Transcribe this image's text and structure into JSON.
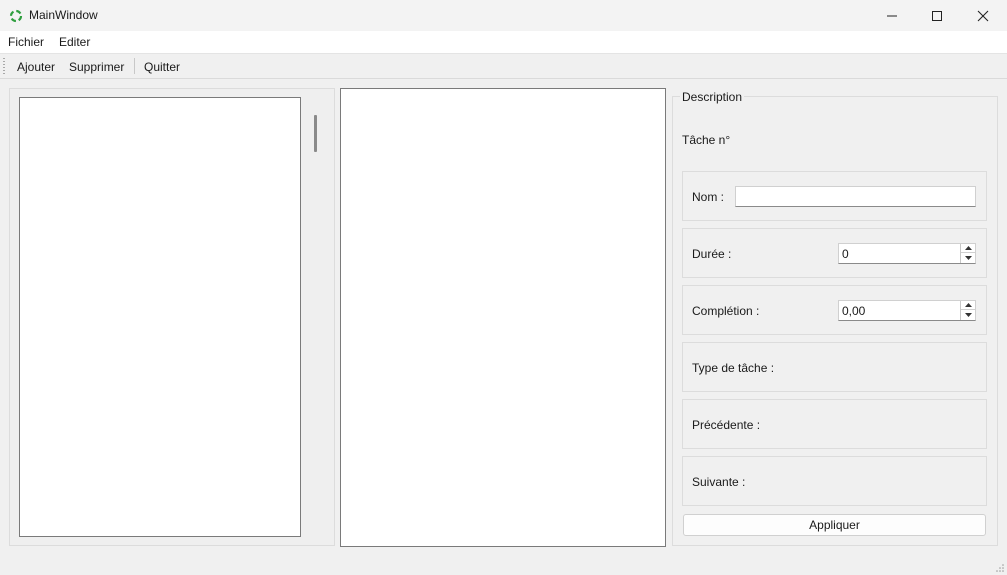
{
  "window": {
    "title": "MainWindow"
  },
  "menu": {
    "items": [
      "Fichier",
      "Editer"
    ]
  },
  "toolbar": {
    "add": "Ajouter",
    "delete": "Supprimer",
    "quit": "Quitter"
  },
  "description": {
    "title": "Description",
    "task_label": "Tâche n°",
    "name_label": "Nom :",
    "name_value": "",
    "duration_label": "Durée :",
    "duration_value": "0",
    "completion_label": "Complétion :",
    "completion_value": "0,00",
    "type_label": "Type de tâche :",
    "previous_label": "Précédente :",
    "next_label": "Suivante :",
    "apply_label": "Appliquer"
  },
  "icons": {
    "app": "qt-app-icon",
    "minimize": "minimize-icon",
    "maximize": "maximize-icon",
    "close": "close-icon"
  }
}
